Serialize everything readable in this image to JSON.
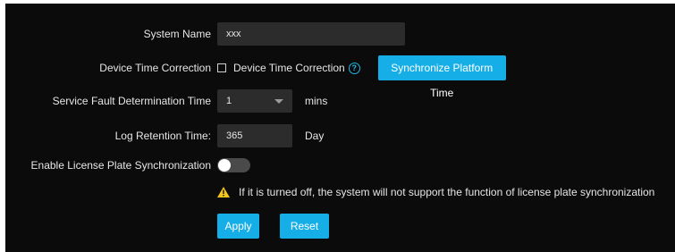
{
  "form": {
    "system_name": {
      "label": "System Name",
      "value": "xxx"
    },
    "device_time_correction": {
      "label": "Device Time Correction",
      "checkbox_label": "Device Time Correction",
      "checked": false,
      "help_icon": "question-circle-icon",
      "sync_button": "Synchronize Platform Time"
    },
    "service_fault": {
      "label": "Service Fault Determination Time",
      "value": "1",
      "unit": "mins"
    },
    "log_retention": {
      "label": "Log Retention Time:",
      "value": "365",
      "unit": "Day"
    },
    "license_plate_sync": {
      "label": "Enable License Plate Synchronization",
      "enabled": false,
      "warning_icon": "warning-triangle-icon",
      "warning": "If it is turned off, the system will not support the function of license plate synchronization"
    }
  },
  "actions": {
    "apply": "Apply",
    "reset": "Reset"
  },
  "colors": {
    "background": "#0b0b0b",
    "accent": "#16aee6",
    "input": "#2c2c2c",
    "warning": "#f5c518"
  }
}
